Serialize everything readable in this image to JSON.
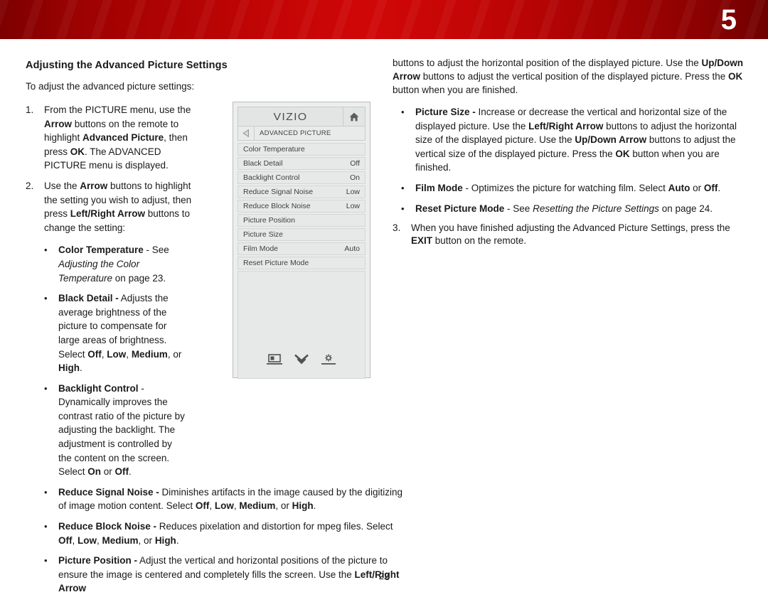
{
  "header": {
    "chapter_number": "5",
    "band_color_mid": "#d00707",
    "band_color_edge": "#7d0000"
  },
  "left_column": {
    "section_title": "Adjusting the Advanced Picture Settings",
    "intro": "To adjust the advanced picture settings:",
    "step1_num": "1.",
    "step2_num": "2.",
    "step2_text_lead": "Use the ",
    "bullet_char": "•",
    "bullets": {
      "color_temperature": "Color Temperature",
      "black_detail": "Black Detail -",
      "backlight_control": "Backlight Control",
      "reduce_signal_noise": "Reduce Signal Noise -",
      "reduce_block_noise": "Reduce Block Noise -",
      "picture_position": "Picture Position -"
    }
  },
  "right_column": {
    "bullets": {
      "picture_size": "Picture Size -",
      "film_mode": "Film Mode",
      "reset_picture_mode": "Reset Picture Mode"
    },
    "step3_num": "3."
  },
  "tv_menu": {
    "brand": "VIZIO",
    "home_icon": "home-icon",
    "back_icon": "back-arrow-icon",
    "breadcrumb_title": "ADVANCED PICTURE",
    "rows": [
      {
        "label": "Color Temperature",
        "value": ""
      },
      {
        "label": "Black Detail",
        "value": "Off"
      },
      {
        "label": "Backlight Control",
        "value": "On"
      },
      {
        "label": "Reduce Signal Noise",
        "value": "Low"
      },
      {
        "label": "Reduce Block Noise",
        "value": "Low"
      },
      {
        "label": "Picture Position",
        "value": ""
      },
      {
        "label": "Picture Size",
        "value": ""
      },
      {
        "label": "Film Mode",
        "value": "Auto"
      },
      {
        "label": "Reset Picture Mode",
        "value": ""
      }
    ],
    "footer_icons": [
      "picture-screen-icon",
      "double-chevron-down-icon",
      "brightness-gear-icon"
    ]
  },
  "footer": {
    "page_number": "22"
  }
}
